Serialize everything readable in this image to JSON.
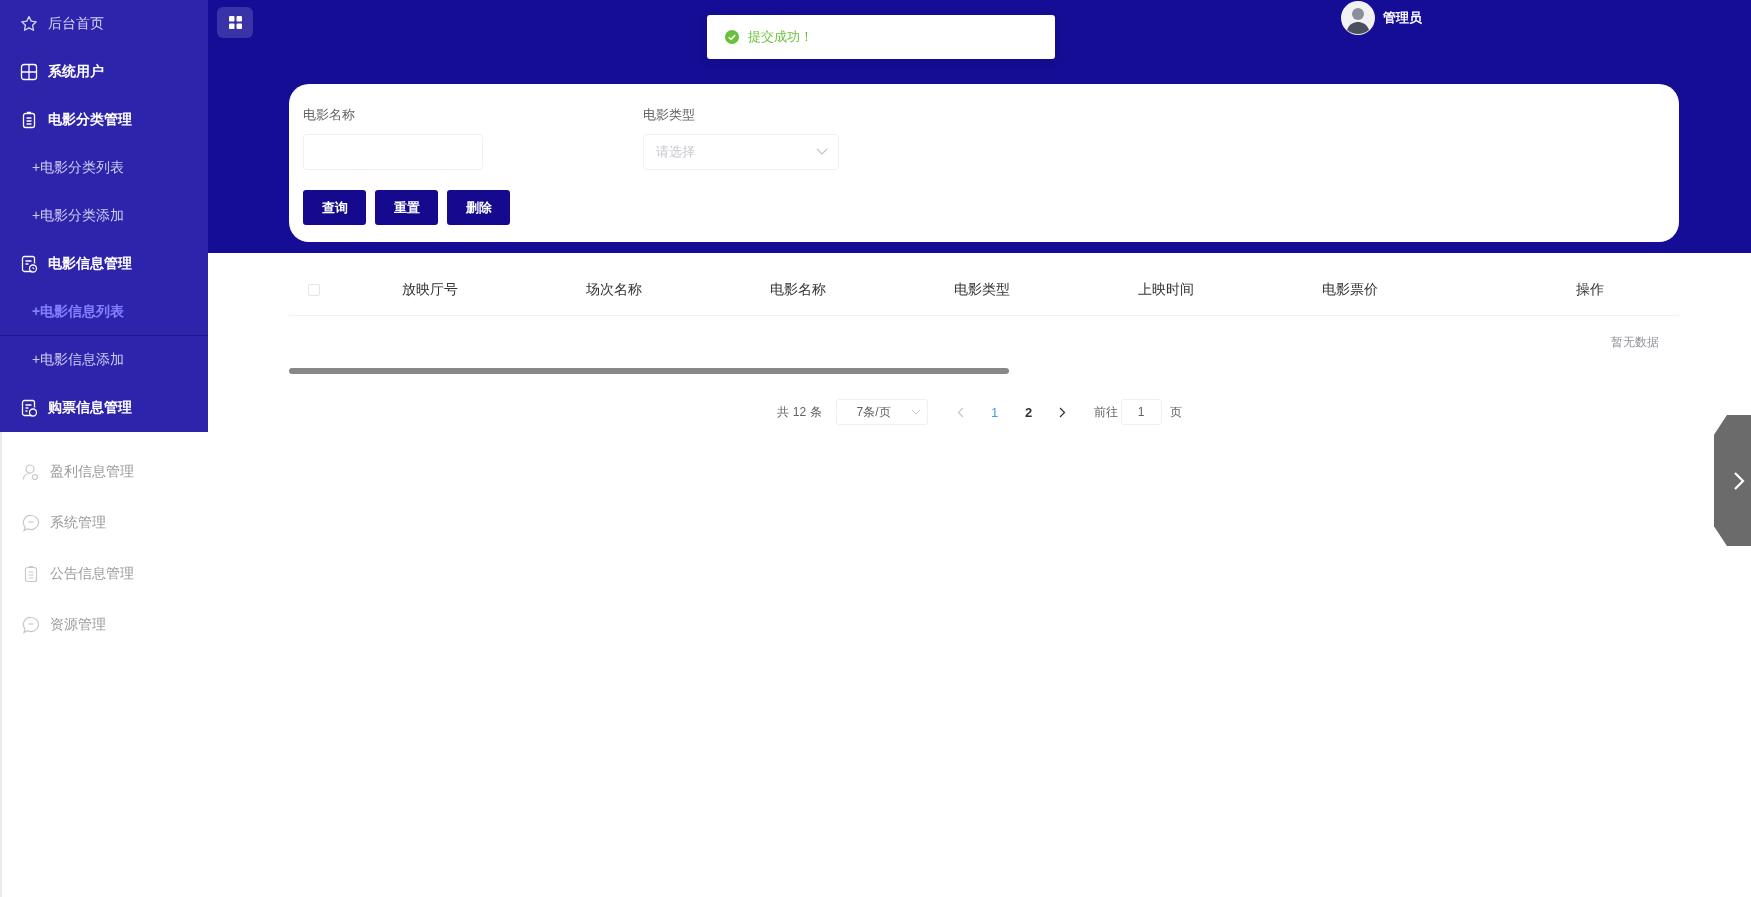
{
  "sidebar": {
    "items": [
      {
        "label": "后台首页",
        "kind": "link",
        "disabled": false
      },
      {
        "label": "系统用户",
        "kind": "group",
        "disabled": false
      },
      {
        "label": "电影分类管理",
        "kind": "group",
        "disabled": false,
        "children": [
          {
            "label": "+电影分类列表",
            "selected": false
          },
          {
            "label": "+电影分类添加",
            "selected": false
          }
        ]
      },
      {
        "label": "电影信息管理",
        "kind": "group",
        "disabled": false,
        "children": [
          {
            "label": "+电影信息列表",
            "selected": true
          },
          {
            "label": "+电影信息添加",
            "selected": false
          }
        ]
      },
      {
        "label": "购票信息管理",
        "kind": "group",
        "disabled": false
      },
      {
        "label": "盈利信息管理",
        "kind": "group",
        "disabled": true
      },
      {
        "label": "系统管理",
        "kind": "group",
        "disabled": true
      },
      {
        "label": "公告信息管理",
        "kind": "group",
        "disabled": true
      },
      {
        "label": "资源管理",
        "kind": "group",
        "disabled": true
      }
    ]
  },
  "header": {
    "user": {
      "name": "管理员"
    }
  },
  "toast": {
    "kind": "success",
    "text": "提交成功！"
  },
  "search_form": {
    "fields": [
      {
        "label": "电影名称",
        "kind": "input"
      },
      {
        "label": "电影类型",
        "kind": "select",
        "placeholder": "请选择"
      }
    ],
    "buttons": [
      {
        "label": "查询"
      },
      {
        "label": "重置"
      },
      {
        "label": "删除"
      }
    ]
  },
  "table": {
    "select_all": {
      "checked": false
    },
    "columns": [
      "放映厅号",
      "场次名称",
      "电影名称",
      "电影类型",
      "上映时间",
      "电影票价",
      "操作"
    ],
    "empty_text": "暂无数据"
  },
  "pagination": {
    "total": "共 12 条",
    "page_size": "7条/页",
    "pages": [
      {
        "label": "1",
        "selected": true
      },
      {
        "label": "2",
        "selected": false
      }
    ],
    "goto_label": "前往",
    "goto_value": "1",
    "goto_suffix": "页"
  }
}
